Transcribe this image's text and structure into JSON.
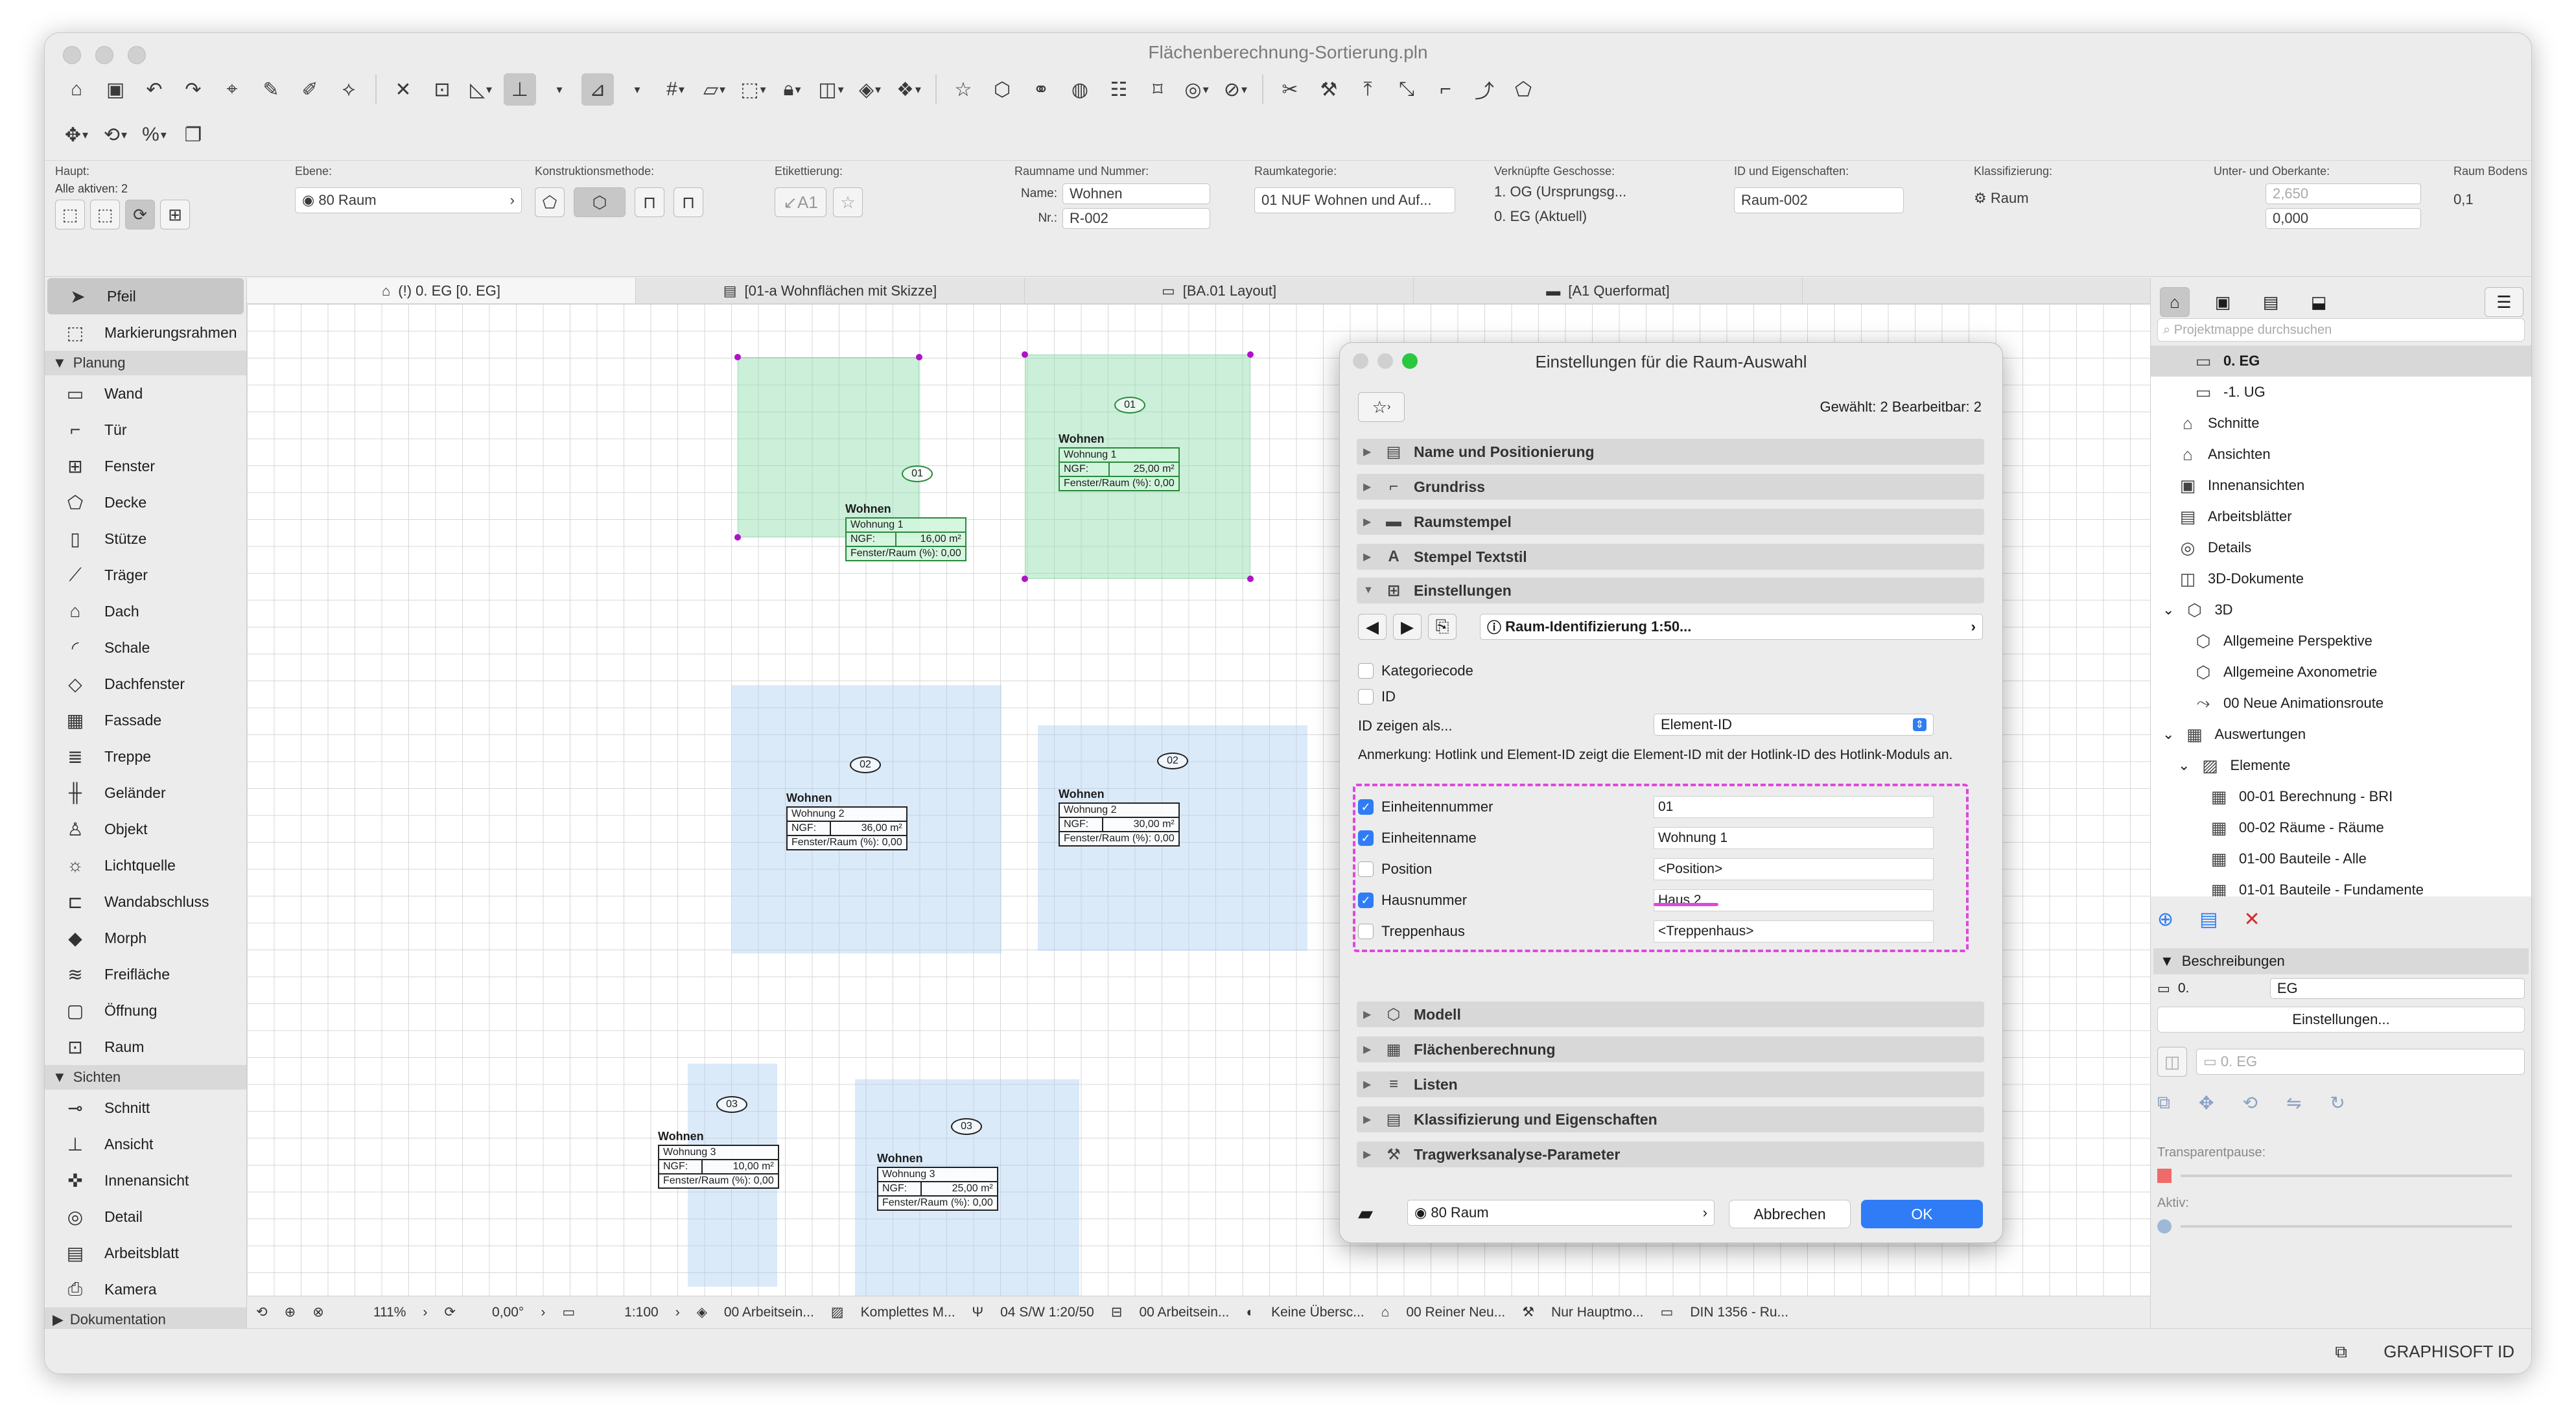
{
  "window": {
    "title": "Flächenberechnung-Sortierung.pln"
  },
  "infobox": {
    "haupt_label": "Haupt:",
    "alle_aktiven": "Alle aktiven: 2",
    "ebene_label": "Ebene:",
    "ebene_value": "80 Raum",
    "konstruktion_label": "Konstruktionsmethode:",
    "etikett_label": "Etikettierung:",
    "etikett_a1": "A1",
    "raumname_label": "Raumname und Nummer:",
    "name_label": "Name:",
    "name_value": "Wohnen",
    "nr_label": "Nr.:",
    "nr_value": "R-002",
    "raumkat_label": "Raumkategorie:",
    "raumkat_value": "01 NUF Wohnen und Auf...",
    "geschosse_label": "Verknüpfte Geschosse:",
    "geschoss_top": "1. OG (Ursprungsg...",
    "geschoss_bottom": "0. EG (Aktuell)",
    "id_label": "ID und Eigenschaften:",
    "id_value": "Raum-002",
    "klass_label": "Klassifizierung:",
    "klass_value": "Raum",
    "ober_label": "Unter- und Oberkante:",
    "ober_value": "2,650",
    "unter_value": "0,000",
    "boden_label": "Raum Bodens",
    "boden_value": "0,1"
  },
  "sidebar": {
    "tools": [
      {
        "label": "Pfeil",
        "icon": "arrow-icon"
      },
      {
        "label": "Markierungsrahmen",
        "icon": "marquee-icon"
      }
    ],
    "planung_header": "Planung",
    "planung": [
      {
        "label": "Wand",
        "icon": "wall-icon"
      },
      {
        "label": "Tür",
        "icon": "door-icon"
      },
      {
        "label": "Fenster",
        "icon": "window-icon"
      },
      {
        "label": "Decke",
        "icon": "slab-icon"
      },
      {
        "label": "Stütze",
        "icon": "column-icon"
      },
      {
        "label": "Träger",
        "icon": "beam-icon"
      },
      {
        "label": "Dach",
        "icon": "roof-icon"
      },
      {
        "label": "Schale",
        "icon": "shell-icon"
      },
      {
        "label": "Dachfenster",
        "icon": "skylight-icon"
      },
      {
        "label": "Fassade",
        "icon": "curtain-wall-icon"
      },
      {
        "label": "Treppe",
        "icon": "stair-icon"
      },
      {
        "label": "Geländer",
        "icon": "railing-icon"
      },
      {
        "label": "Objekt",
        "icon": "object-icon"
      },
      {
        "label": "Lichtquelle",
        "icon": "lamp-icon"
      },
      {
        "label": "Wandabschluss",
        "icon": "wall-end-icon"
      },
      {
        "label": "Morph",
        "icon": "morph-icon"
      },
      {
        "label": "Freifläche",
        "icon": "mesh-icon"
      },
      {
        "label": "Öffnung",
        "icon": "opening-icon"
      },
      {
        "label": "Raum",
        "icon": "zone-icon"
      }
    ],
    "sichten_header": "Sichten",
    "sichten": [
      {
        "label": "Schnitt",
        "icon": "section-icon"
      },
      {
        "label": "Ansicht",
        "icon": "elevation-icon"
      },
      {
        "label": "Innenansicht",
        "icon": "interior-elevation-icon"
      },
      {
        "label": "Detail",
        "icon": "detail-icon"
      },
      {
        "label": "Arbeitsblatt",
        "icon": "worksheet-icon"
      },
      {
        "label": "Kamera",
        "icon": "camera-icon"
      }
    ],
    "doku_header": "Dokumentation"
  },
  "tabs": [
    {
      "label": "(!) 0. EG [0. EG]"
    },
    {
      "label": "[01-a Wohnflächen mit Skizze]"
    },
    {
      "label": "[BA.01 Layout]"
    },
    {
      "label": "[A1 Querformat]"
    }
  ],
  "rooms": [
    {
      "num": "01",
      "name": "Wohnen",
      "unit": "Wohnung 1",
      "ngf_label": "NGF:",
      "ngf": "16,00 m²",
      "fenster": "Fenster/Raum (%): 0,00"
    },
    {
      "num": "01",
      "name": "Wohnen",
      "unit": "Wohnung 1",
      "ngf_label": "NGF:",
      "ngf": "25,00 m²",
      "fenster": "Fenster/Raum (%): 0,00"
    },
    {
      "num": "02",
      "name": "Wohnen",
      "unit": "Wohnung 2",
      "ngf_label": "NGF:",
      "ngf": "36,00 m²",
      "fenster": "Fenster/Raum (%): 0,00"
    },
    {
      "num": "02",
      "name": "Wohnen",
      "unit": "Wohnung 2",
      "ngf_label": "NGF:",
      "ngf": "30,00 m²",
      "fenster": "Fenster/Raum (%): 0,00"
    },
    {
      "num": "03",
      "name": "Wohnen",
      "unit": "Wohnung 3",
      "ngf_label": "NGF:",
      "ngf": "10,00 m²",
      "fenster": "Fenster/Raum (%): 0,00"
    },
    {
      "num": "03",
      "name": "Wohnen",
      "unit": "Wohnung 3",
      "ngf_label": "NGF:",
      "ngf": "25,00 m²",
      "fenster": "Fenster/Raum (%): 0,00"
    }
  ],
  "status": {
    "zoom": "111%",
    "angle": "0,00°",
    "scale": "1:100",
    "layer": "00 Arbeitsein...",
    "model": "Komplettes M...",
    "pen": "04 S/W 1:20/50",
    "layer2": "00 Arbeitsein...",
    "override": "Keine Übersc...",
    "reno": "00 Reiner Neu...",
    "struct": "Nur Hauptmo...",
    "norm": "DIN 1356 - Ru..."
  },
  "right": {
    "search_placeholder": "Projektmappe durchsuchen",
    "tree": [
      {
        "label": "0. EG",
        "icon": "story-icon",
        "sel": true
      },
      {
        "label": "-1. UG",
        "icon": "story-icon"
      },
      {
        "label": "Schnitte",
        "icon": "section-folder-icon"
      },
      {
        "label": "Ansichten",
        "icon": "elevation-folder-icon"
      },
      {
        "label": "Innenansichten",
        "icon": "interior-folder-icon"
      },
      {
        "label": "Arbeitsblätter",
        "icon": "worksheet-folder-icon"
      },
      {
        "label": "Details",
        "icon": "detail-folder-icon"
      },
      {
        "label": "3D-Dokumente",
        "icon": "3d-doc-icon"
      },
      {
        "label": "3D",
        "icon": "3d-icon"
      },
      {
        "label": "Allgemeine Perspektive",
        "icon": "perspective-icon"
      },
      {
        "label": "Allgemeine Axonometrie",
        "icon": "axonometry-icon"
      },
      {
        "label": "00 Neue Animationsroute",
        "icon": "path-icon"
      },
      {
        "label": "Auswertungen",
        "icon": "schedule-icon"
      },
      {
        "label": "Elemente",
        "icon": "elements-icon"
      },
      {
        "label": "00-01 Berechnung - BRI",
        "icon": "table-icon"
      },
      {
        "label": "00-02 Räume - Räume",
        "icon": "table-icon"
      },
      {
        "label": "01-00 Bauteile - Alle",
        "icon": "table-icon"
      },
      {
        "label": "01-01 Bauteile - Fundamente",
        "icon": "table-icon"
      }
    ],
    "beschreibungen": "Beschreibungen",
    "desc_num": "0.",
    "desc_name": "EG",
    "einstellungen_btn": "Einstellungen...",
    "view_field": "0. EG",
    "transparent_label": "Transparentpause:",
    "aktiv_label": "Aktiv:"
  },
  "footer": {
    "brand": "GRAPHISOFT ID"
  },
  "dialog": {
    "title": "Einstellungen für die Raum-Auswahl",
    "selection": "Gewählt: 2 Bearbeitbar: 2",
    "sections_top": [
      {
        "label": "Name und Positionierung",
        "icon": "name-icon"
      },
      {
        "label": "Grundriss",
        "icon": "floorplan-icon"
      },
      {
        "label": "Raumstempel",
        "icon": "stamp-icon"
      },
      {
        "label": "Stempel Textstil",
        "icon": "textstyle-icon"
      }
    ],
    "einstellungen": "Einstellungen",
    "stamp_selector": "Raum-Identifizierung 1:50...",
    "kategoriecode": "Kategoriecode",
    "id": "ID",
    "id_show_label": "ID zeigen als...",
    "id_show_value": "Element-ID",
    "note": "Anmerkung: Hotlink und Element-ID zeigt die Element-ID mit der Hotlink-ID des Hotlink-Moduls an.",
    "fields": [
      {
        "label": "Einheitennummer",
        "value": "01",
        "checked": true
      },
      {
        "label": "Einheitenname",
        "value": "Wohnung 1",
        "checked": true
      },
      {
        "label": "Position",
        "value": "<Position>",
        "checked": false
      },
      {
        "label": "Hausnummer",
        "value": "Haus 2",
        "checked": true
      },
      {
        "label": "Treppenhaus",
        "value": "<Treppenhaus>",
        "checked": false
      }
    ],
    "sections_bottom": [
      {
        "label": "Modell",
        "icon": "model-icon"
      },
      {
        "label": "Flächenberechnung",
        "icon": "area-icon"
      },
      {
        "label": "Listen",
        "icon": "list-icon"
      },
      {
        "label": "Klassifizierung und Eigenschaften",
        "icon": "classification-icon"
      },
      {
        "label": "Tragwerksanalyse-Parameter",
        "icon": "structure-icon"
      }
    ],
    "layer": "80 Raum",
    "cancel": "Abbrechen",
    "ok": "OK"
  }
}
